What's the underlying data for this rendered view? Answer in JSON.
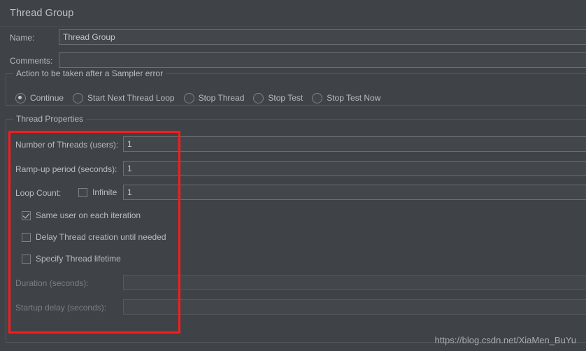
{
  "panel": {
    "title": "Thread Group"
  },
  "fields": {
    "name_label": "Name:",
    "name_value": "Thread Group",
    "comments_label": "Comments:",
    "comments_value": ""
  },
  "sampler_error": {
    "group_title": "Action to be taken after a Sampler error",
    "options": [
      {
        "label": "Continue",
        "selected": true
      },
      {
        "label": "Start Next Thread Loop",
        "selected": false
      },
      {
        "label": "Stop Thread",
        "selected": false
      },
      {
        "label": "Stop Test",
        "selected": false
      },
      {
        "label": "Stop Test Now",
        "selected": false
      }
    ]
  },
  "thread_properties": {
    "group_title": "Thread Properties",
    "number_of_threads_label": "Number of Threads (users):",
    "number_of_threads_value": "1",
    "ramp_up_label": "Ramp-up period (seconds):",
    "ramp_up_value": "1",
    "loop_count_label": "Loop Count:",
    "loop_count_value": "1",
    "infinite_label": "Infinite",
    "infinite_checked": false,
    "same_user_label": "Same user on each iteration",
    "same_user_checked": true,
    "delay_thread_label": "Delay Thread creation until needed",
    "delay_thread_checked": false,
    "specify_lifetime_label": "Specify Thread lifetime",
    "specify_lifetime_checked": false,
    "duration_label": "Duration (seconds):",
    "duration_value": "",
    "startup_delay_label": "Startup delay (seconds):",
    "startup_delay_value": ""
  },
  "annotation": {
    "highlight_color": "#fc1b1b"
  },
  "watermark": {
    "text": "https://blog.csdn.net/XiaMen_BuYu"
  }
}
